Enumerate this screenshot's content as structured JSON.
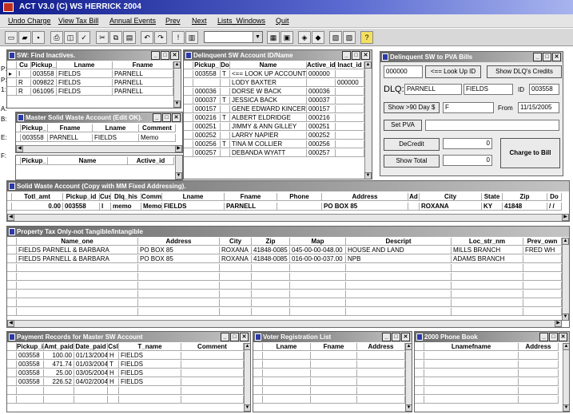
{
  "app": {
    "title": "ACT V3.0 (C) WS HERRICK 2004"
  },
  "menu": [
    "Undo Charge",
    "View Tax Bill",
    "Annual Events",
    "Prev",
    "Next",
    "Lists_Windows",
    "Quit"
  ],
  "find_inactives": {
    "title": "SW: Find Inactives.",
    "headers": [
      "Cu",
      "Pickup_",
      "Lname",
      "Fname"
    ],
    "rows": [
      [
        "I",
        "003558",
        "FIELDS",
        "PARNELL"
      ],
      [
        "R",
        "009822",
        "FIELDS",
        "PARNELL"
      ],
      [
        "R",
        "061095",
        "FIELDS",
        "PARNELL"
      ]
    ]
  },
  "delinquent_list": {
    "title": "Delinquent SW Account ID/Name",
    "headers": [
      "Pickup_",
      "Do",
      "Name",
      "Active_id",
      "Inact_id"
    ],
    "rows": [
      [
        "003558",
        "T",
        "<== LOOK UP ACCOUNT",
        "000000",
        ""
      ],
      [
        "",
        "",
        "LODY BAXTER",
        "",
        "000000"
      ],
      [
        "000036",
        "",
        "DORSE W BACK",
        "000036",
        ""
      ],
      [
        "000037",
        "T",
        "JESSICA BACK",
        "000037",
        ""
      ],
      [
        "000157",
        "",
        "GENE EDWARD KINCER",
        "000157",
        ""
      ],
      [
        "000216",
        "T",
        "ALBERT ELDRIDGE",
        "000216",
        ""
      ],
      [
        "000251",
        "",
        "JIMMY & ANN GILLEY",
        "000251",
        ""
      ],
      [
        "000252",
        "",
        "LARRY NAPIER",
        "000252",
        ""
      ],
      [
        "000256",
        "T",
        "TINA M COLLIER",
        "000256",
        ""
      ],
      [
        "000257",
        "",
        "DEBANDA WYATT",
        "000257",
        ""
      ]
    ]
  },
  "pva": {
    "title": "Delinquent SW to PVA Bills",
    "id_value": "000000",
    "lookup_label": "<== Look Up ID",
    "show_dlq_label": "Show DLQ's Credits",
    "dlq_label": "DLQ:",
    "dlq_lname": "PARNELL",
    "dlq_fname": "FIELDS",
    "id_label": "ID",
    "id_field": "003558",
    "show90_label": "Show >90 Day $",
    "show90_value": "F",
    "from_label": "From",
    "from_date": "11/15/2005",
    "setpva_label": "Set PVA",
    "decredit_label": "DeCredit",
    "decredit_value": "0",
    "showtotal_label": "Show Total",
    "showtotal_value": "0",
    "charge_label": "Charge to Bill"
  },
  "master_sw": {
    "title": "Master Solid Waste Account (Edit OK).",
    "headers": [
      "Pickup_",
      "Fname",
      "Lname",
      "Comment"
    ],
    "row": [
      "003558",
      "PARNELL",
      "FIELDS",
      "Memo"
    ]
  },
  "lower_left": {
    "headers": [
      "Pickup_",
      "Name",
      "Active_id"
    ]
  },
  "left_labels": [
    "P:",
    "P:",
    "1:",
    "A:",
    "B:",
    "E:",
    "F:"
  ],
  "solid_waste": {
    "title": "Solid Waste  Account  (Copy with MM Fixed Addressing).",
    "headers": [
      "Totl_amt",
      "Pickup_id",
      "Cus",
      "Dlq_his",
      "Comm",
      "Lname",
      "Fname",
      "Phone",
      "Address",
      "Ad",
      "City",
      "State",
      "Zip",
      "Do"
    ],
    "row": [
      "0.00",
      "003558",
      "I",
      "memo",
      "Memo",
      "FIELDS",
      "PARNELL",
      "",
      "PO BOX 85",
      "",
      "ROXANA",
      "KY",
      "41848",
      "/ /"
    ]
  },
  "property_tax": {
    "title": "Property Tax Only-not Tangible/Intangible",
    "headers": [
      "Name_one",
      "Address",
      "City",
      "Zip",
      "Map",
      "Descript",
      "Loc_str_nm",
      "Prev_own"
    ],
    "rows": [
      [
        "FIELDS PARNELL & BARBARA",
        "PO BOX 85",
        "ROXANA",
        "41848-0085",
        "045-00-00-048.00",
        "HOUSE AND LAND",
        "MILLS BRANCH",
        "FRED WH"
      ],
      [
        "FIELDS PARNELL & BARBARA",
        "PO BOX 85",
        "ROXANA",
        "41848-0085",
        "016-00-00-037.00",
        "NPB",
        "ADAMS BRANCH",
        ""
      ]
    ]
  },
  "payments": {
    "title": "Payment Records for Master SW Account",
    "headers": [
      "Pickup_i",
      "Amt_paid",
      "Date_paid",
      "Csl",
      "T_name",
      "Comment"
    ],
    "rows": [
      [
        "003558",
        "100.00",
        "01/13/2004",
        "H",
        "FIELDS",
        ""
      ],
      [
        "003558",
        "471.74",
        "01/03/2004",
        "T",
        "FIELDS",
        ""
      ],
      [
        "003558",
        "25.00",
        "03/05/2004",
        "H",
        "FIELDS",
        ""
      ],
      [
        "003558",
        "226.52",
        "04/02/2004",
        "H",
        "FIELDS",
        ""
      ]
    ]
  },
  "voter": {
    "title": "Voter Registration List",
    "headers": [
      "Lname",
      "Fname",
      "Address"
    ]
  },
  "phonebook": {
    "title": "2000 Phone Book",
    "headers": [
      "Lnamefname",
      "Address"
    ]
  },
  "colors": {
    "highlight": "#fffba0",
    "titlebar": "#101c8c"
  }
}
